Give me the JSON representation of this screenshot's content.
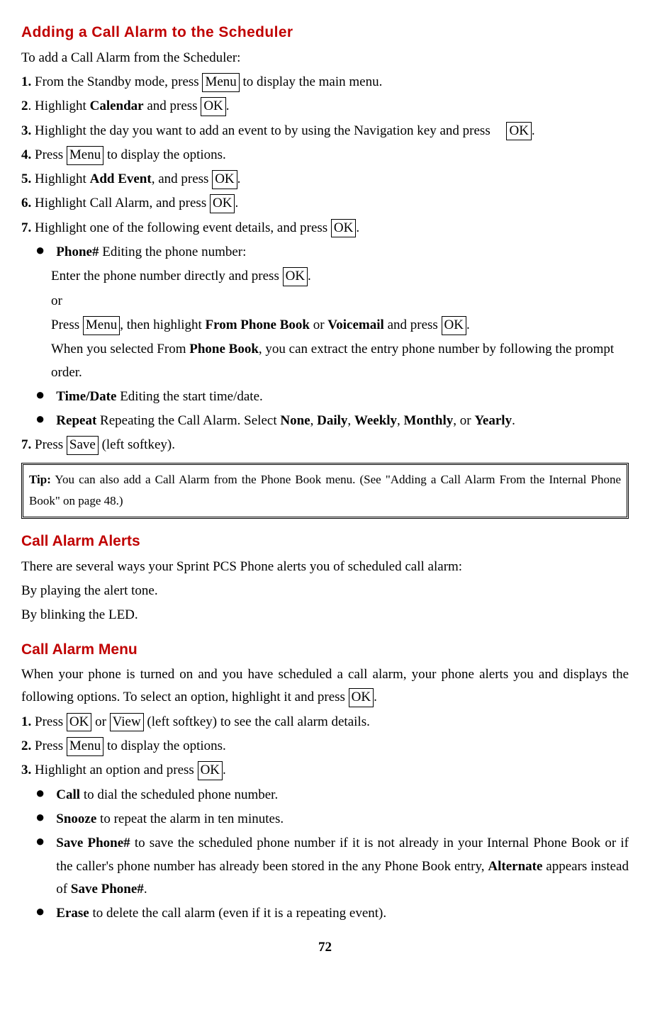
{
  "section1": {
    "title": "Adding a Call Alarm to the Scheduler",
    "intro": "To add a Call Alarm from the Scheduler:",
    "step1_num": "1.",
    "step1_a": " From the Standby mode, press ",
    "step1_key": "Menu",
    "step1_b": " to display the main menu.",
    "step2_num": "2",
    "step2_a": ". Highlight ",
    "step2_bold": "Calendar",
    "step2_b": " and press ",
    "step2_key": "OK",
    "step2_c": ".",
    "step3_num": "3.",
    "step3_a": " Highlight the day you want to add an event to by using the Navigation key and press ",
    "step3_key": "OK",
    "step3_b": ".",
    "step4_num": "4.",
    "step4_a": " Press ",
    "step4_key": "Menu",
    "step4_b": " to display the options.",
    "step5_num": "5.",
    "step5_a": " Highlight ",
    "step5_bold": "Add Event",
    "step5_b": ", and press ",
    "step5_key": "OK",
    "step5_c": ".",
    "step6_num": "6.",
    "step6_a": " Highlight Call Alarm, and press ",
    "step6_key": "OK",
    "step6_b": ".",
    "step7_num": "7.",
    "step7_a": " Highlight one of the following event details, and press ",
    "step7_key": "OK",
    "step7_b": ".",
    "bullet1_bold": "Phone#",
    "bullet1_a": " Editing the phone number:",
    "b1_line1_a": "Enter the phone number directly and press ",
    "b1_line1_key": "OK",
    "b1_line1_b": ".",
    "b1_or": "or",
    "b1_line2_a": "Press ",
    "b1_line2_key1": "Menu",
    "b1_line2_b": ", then highlight ",
    "b1_line2_bold1": "From Phone Book",
    "b1_line2_c": " or ",
    "b1_line2_bold2": "Voicemail",
    "b1_line2_d": " and press ",
    "b1_line2_key2": "OK",
    "b1_line2_e": ".",
    "b1_line3_a": "When you selected From ",
    "b1_line3_bold": "Phone Book",
    "b1_line3_b": ", you can extract the entry phone number by following the prompt order.",
    "bullet2_bold": "Time/Date",
    "bullet2_a": " Editing the start time/date.",
    "bullet3_bold": "Repeat",
    "bullet3_a": " Repeating the Call Alarm. Select ",
    "bullet3_b1": "None",
    "bullet3_c1": ", ",
    "bullet3_b2": "Daily",
    "bullet3_c2": ", ",
    "bullet3_b3": "Weekly",
    "bullet3_c3": ", ",
    "bullet3_b4": "Monthly",
    "bullet3_c4": ", or ",
    "bullet3_b5": "Yearly",
    "bullet3_c5": ".",
    "step7b_num": "7.",
    "step7b_a": " Press ",
    "step7b_key": "Save",
    "step7b_b": " (left softkey).",
    "tip_bold": "Tip:",
    "tip_text": " You can also add a Call Alarm from the Phone Book menu. (See \"Adding a Call Alarm From the Internal Phone Book\" on page 48.)"
  },
  "section2": {
    "title": "Call Alarm Alerts",
    "line1": "There are several ways your Sprint PCS Phone alerts you of scheduled call alarm:",
    "line2": "By playing the alert tone.",
    "line3": "By blinking the LED."
  },
  "section3": {
    "title": "Call Alarm Menu",
    "intro_a": "When your phone is turned on and you have scheduled a call alarm, your phone alerts you and displays the following options. To select an option, highlight it and press ",
    "intro_key": "OK",
    "intro_b": ".",
    "step1_num": "1.",
    "step1_a": " Press ",
    "step1_key1": "OK",
    "step1_b": " or ",
    "step1_key2": "View",
    "step1_c": " (left softkey) to see the call alarm details.",
    "step2_num": "2.",
    "step2_a": " Press ",
    "step2_key": "Menu",
    "step2_b": " to display the options.",
    "step3_num": "3.",
    "step3_a": " Highlight an option and press ",
    "step3_key": "OK",
    "step3_b": ".",
    "bullet1_bold": "Call",
    "bullet1_a": " to dial the scheduled phone number.",
    "bullet2_bold": "Snooze",
    "bullet2_a": " to repeat the alarm in ten minutes.",
    "bullet3_bold": "Save Phone#",
    "bullet3_a": " to save the scheduled phone number if it is not already in your Internal Phone Book or if the caller's phone number has already been stored in the any Phone Book entry, ",
    "bullet3_bold2": "Alternate",
    "bullet3_b": " appears instead of ",
    "bullet3_bold3": "Save Phone#",
    "bullet3_c": ".",
    "bullet4_bold": "Erase",
    "bullet4_a": " to delete the call alarm (even if it is a repeating event)."
  },
  "page_number": "72"
}
